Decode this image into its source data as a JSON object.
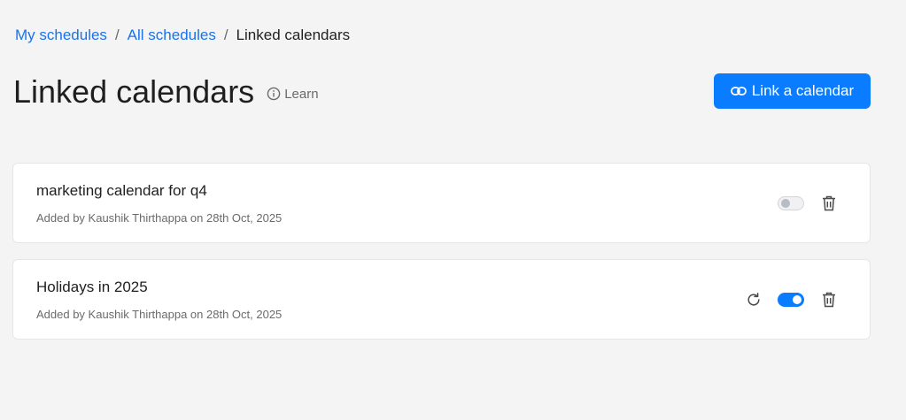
{
  "breadcrumb": {
    "items": [
      "My schedules",
      "All schedules"
    ],
    "separator": "/",
    "current": "Linked calendars"
  },
  "header": {
    "title": "Linked calendars",
    "learn_label": "Learn",
    "primary_action": "Link a calendar"
  },
  "calendars": [
    {
      "name": "marketing calendar for q4",
      "meta": "Added by Kaushik Thirthappa on 28th Oct, 2025",
      "enabled": false,
      "show_refresh": false
    },
    {
      "name": "Holidays in 2025",
      "meta": "Added by Kaushik Thirthappa on 28th Oct, 2025",
      "enabled": true,
      "show_refresh": true
    }
  ],
  "icons": {
    "learn": "info-icon",
    "link": "link-icon",
    "delete": "trash-icon",
    "sync": "refresh-icon"
  },
  "colors": {
    "accent": "#0a7cff",
    "link": "#1a73e8",
    "background": "#f4f4f5"
  }
}
